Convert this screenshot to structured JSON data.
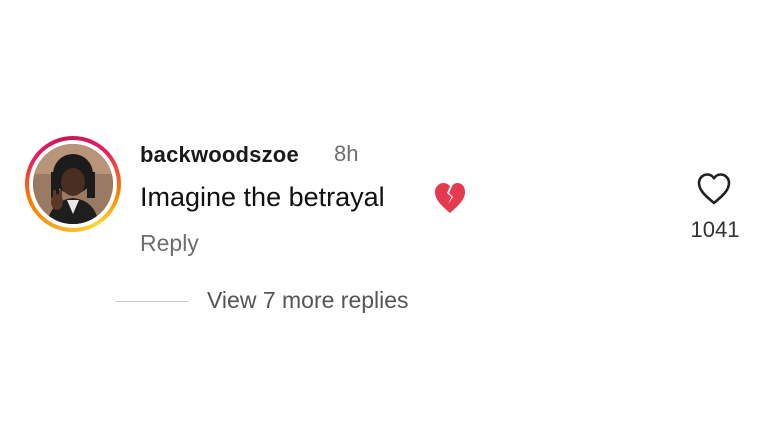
{
  "comment": {
    "username": "backwoodszoe",
    "time_ago": "8h",
    "text": "Imagine the betrayal",
    "emoji": "broken-heart-emoji",
    "reply_label": "Reply",
    "like_count": "1041",
    "view_replies_label": "View 7 more replies"
  },
  "colors": {
    "emoji_red": "#e53950",
    "story_ring_start": "#f9a825",
    "story_ring_end": "#e91e63",
    "secondary_text": "#6e6e6e"
  }
}
